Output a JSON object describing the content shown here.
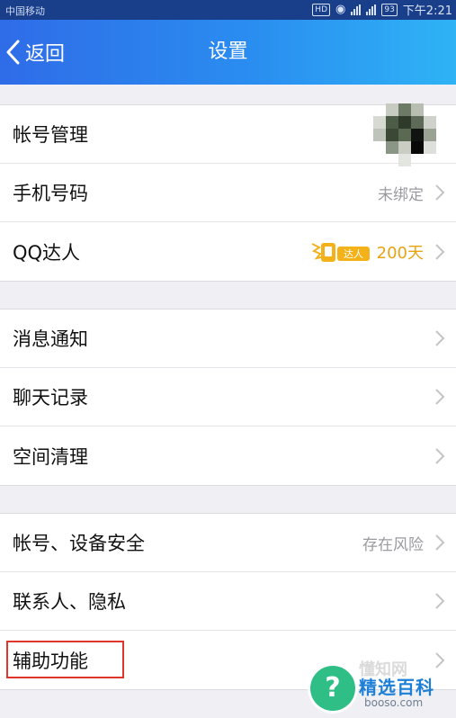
{
  "status_bar": {
    "carrier": "中国移动",
    "hd": "HD",
    "battery": "93",
    "time": "下午2:21"
  },
  "nav": {
    "back_label": "返回",
    "title": "设置"
  },
  "groups": [
    {
      "rows": [
        {
          "name": "account-management",
          "label": "帐号管理",
          "value": "",
          "icon": "avatar-thumbnail"
        },
        {
          "name": "phone-number",
          "label": "手机号码",
          "value": "未绑定",
          "icon": "chevron-right-icon"
        },
        {
          "name": "qq-talent",
          "label": "QQ达人",
          "badge": "达人",
          "value": "200天",
          "icon": "chevron-right-icon"
        }
      ]
    },
    {
      "rows": [
        {
          "name": "message-notification",
          "label": "消息通知",
          "value": "",
          "icon": "chevron-right-icon"
        },
        {
          "name": "chat-history",
          "label": "聊天记录",
          "value": "",
          "icon": "chevron-right-icon"
        },
        {
          "name": "storage-cleanup",
          "label": "空间清理",
          "value": "",
          "icon": "chevron-right-icon"
        }
      ]
    },
    {
      "rows": [
        {
          "name": "account-device-security",
          "label": "帐号、设备安全",
          "value": "存在风险",
          "icon": "chevron-right-icon"
        },
        {
          "name": "contacts-privacy",
          "label": "联系人、隐私",
          "value": "",
          "icon": "chevron-right-icon"
        },
        {
          "name": "accessibility",
          "label": "辅助功能",
          "value": "",
          "icon": "chevron-right-icon"
        }
      ]
    }
  ],
  "colors": {
    "accent": "#2a8df0",
    "highlight": "#e0352b",
    "talent": "#e8a314"
  },
  "watermark": {
    "icon": "question-mark-icon",
    "ghost_text": "懂知网",
    "title": "精选百科",
    "site": "booso.com"
  }
}
